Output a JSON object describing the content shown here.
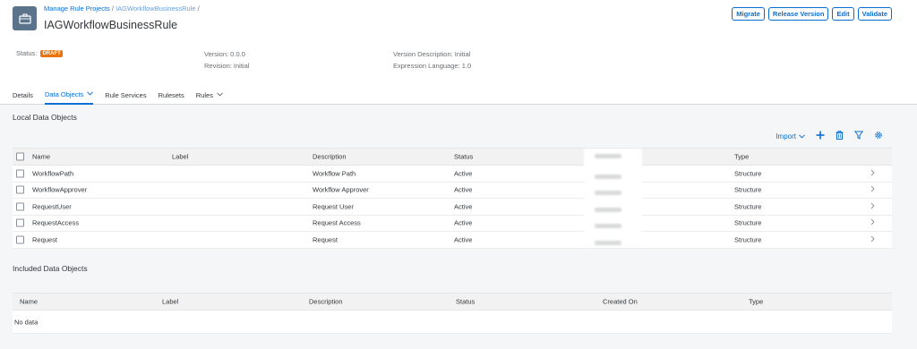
{
  "header": {
    "breadcrumb": {
      "link1": "Manage Rule Projects",
      "sep": "/",
      "link2": "IAGWorkflowBusinessRule",
      "trail": "/"
    },
    "title": "IAGWorkflowBusinessRule",
    "actions": [
      "Migrate",
      "Release Version",
      "Edit",
      "Validate"
    ]
  },
  "attributes": {
    "status_label": "Status:",
    "status_value": "DRAFT",
    "version": "Version: 0.0.0",
    "revision": "Revision: Initial",
    "version_description": "Version Description: Initial",
    "expression_language": "Expression Language: 1.0"
  },
  "tabs": [
    {
      "label": "Details",
      "dropdown": false,
      "active": false
    },
    {
      "label": "Data Objects",
      "dropdown": true,
      "active": true
    },
    {
      "label": "Rule Services",
      "dropdown": false,
      "active": false
    },
    {
      "label": "Rulesets",
      "dropdown": false,
      "active": false
    },
    {
      "label": "Rules",
      "dropdown": true,
      "active": false
    }
  ],
  "local": {
    "title": "Local Data Objects",
    "toolbar": {
      "import_label": "Import"
    },
    "columns": [
      "Name",
      "Label",
      "Description",
      "Status",
      "Type"
    ],
    "rows": [
      {
        "name": "WorkflowPath",
        "label": "",
        "description": "Workflow Path",
        "status": "Active",
        "type": "Structure"
      },
      {
        "name": "WorkflowApprover",
        "label": "",
        "description": "Workflow Approver",
        "status": "Active",
        "type": "Structure"
      },
      {
        "name": "RequestUser",
        "label": "",
        "description": "Request User",
        "status": "Active",
        "type": "Structure"
      },
      {
        "name": "RequestAccess",
        "label": "",
        "description": "Request Access",
        "status": "Active",
        "type": "Structure"
      },
      {
        "name": "Request",
        "label": "",
        "description": "Request",
        "status": "Active",
        "type": "Structure"
      }
    ]
  },
  "included": {
    "title": "Included Data Objects",
    "columns": [
      "Name",
      "Label",
      "Description",
      "Status",
      "Created On",
      "Type"
    ],
    "empty_text": "No data"
  },
  "colors": {
    "accent": "#0a6ed1",
    "draft": "#e9730c",
    "header_bg": "#ffffff",
    "page_bg": "#f5f6f7"
  },
  "icons": [
    "briefcase-icon",
    "chevron-down-icon",
    "add-icon",
    "delete-icon",
    "filter-icon",
    "settings-icon",
    "chevron-right-icon"
  ]
}
